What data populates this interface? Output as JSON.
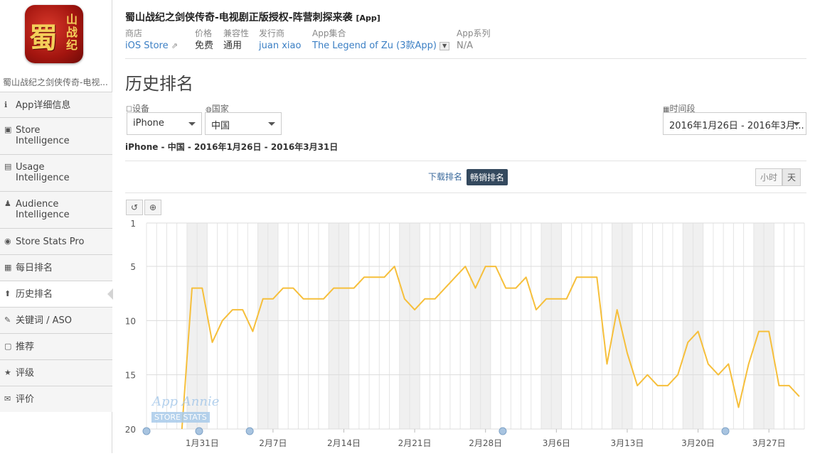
{
  "app": {
    "title": "蜀山战纪之剑侠传奇-电视剧正版授权-阵营刺探来袭",
    "tag": "[App]",
    "sidebar_name": "蜀山战纪之剑侠传奇-电视...",
    "icon_text": "蜀",
    "icon_text2": "山战纪"
  },
  "meta": [
    {
      "key": "商店",
      "value": "iOS Store",
      "link": true
    },
    {
      "key": "价格",
      "value": "免费",
      "link": false
    },
    {
      "key": "兼容性",
      "value": "通用",
      "link": false
    },
    {
      "key": "发行商",
      "value": "juan xiao",
      "link": true
    },
    {
      "key": "App集合",
      "value": "The Legend of Zu (3款App)",
      "link": true
    },
    {
      "key": "App系列",
      "value": "N/A",
      "link": false
    }
  ],
  "nav": [
    {
      "label": "App详细信息",
      "icon": "info-icon",
      "glyph": "ℹ"
    },
    {
      "label": "Store\nIntelligence",
      "icon": "store-icon",
      "glyph": "▣"
    },
    {
      "label": "Usage\nIntelligence",
      "icon": "usage-icon",
      "glyph": "▤"
    },
    {
      "label": "Audience\nIntelligence",
      "icon": "person-icon",
      "glyph": "♟"
    },
    {
      "label": "Store Stats Pro",
      "icon": "pro-icon",
      "glyph": "◉"
    },
    {
      "label": "每日排名",
      "icon": "calendar-icon",
      "glyph": "▦"
    },
    {
      "label": "历史排名",
      "icon": "arrow-up-icon",
      "glyph": "⬆"
    },
    {
      "label": "关键词 / ASO",
      "icon": "keyword-icon",
      "glyph": "✎"
    },
    {
      "label": "推荐",
      "icon": "feature-icon",
      "glyph": "▢"
    },
    {
      "label": "评级",
      "icon": "star-icon",
      "glyph": "★"
    },
    {
      "label": "评价",
      "icon": "comment-icon",
      "glyph": "✉"
    }
  ],
  "page_title": "历史排名",
  "filters": {
    "device_label": "设备",
    "device_value": "iPhone",
    "country_label": "国家",
    "country_value": "中国",
    "period_label": "时间段",
    "period_value": "2016年1月26日 - 2016年3月..."
  },
  "range_text": "iPhone - 中国 - 2016年1月26日 - 2016年3月31日",
  "toggles": {
    "downloads": "下载排名",
    "grossing": "畅销排名",
    "hour": "小时",
    "day": "天"
  },
  "watermark": {
    "line1": "App Annie",
    "line2": "STORE STATS"
  },
  "colors": {
    "line": "#f6bf3b",
    "weekend": "#f0f0f0",
    "link": "#3b7fc4"
  },
  "chart_data": {
    "type": "line",
    "start_date": "2016-01-26",
    "y_inverted": true,
    "ylim": [
      1,
      20
    ],
    "yticks": [
      1,
      5,
      10,
      15,
      20
    ],
    "xtick_labels": [
      "1月31日",
      "2月7日",
      "2月14日",
      "2月21日",
      "2月28日",
      "3月6日",
      "3月13日",
      "3月20日",
      "3月27日"
    ],
    "series": [
      {
        "values": [
          null,
          null,
          null,
          20,
          7,
          7,
          12,
          10,
          9,
          9,
          11,
          8,
          8,
          7,
          7,
          8,
          8,
          8,
          7,
          7,
          7,
          6,
          6,
          6,
          5,
          8,
          9,
          8,
          8,
          7,
          6,
          5,
          7,
          5,
          5,
          7,
          7,
          6,
          9,
          8,
          8,
          8,
          6,
          6,
          6,
          14,
          9,
          13,
          16,
          15,
          16,
          16,
          15,
          12,
          11,
          14,
          15,
          14,
          18,
          14,
          11,
          11,
          16,
          16,
          17
        ]
      }
    ]
  }
}
